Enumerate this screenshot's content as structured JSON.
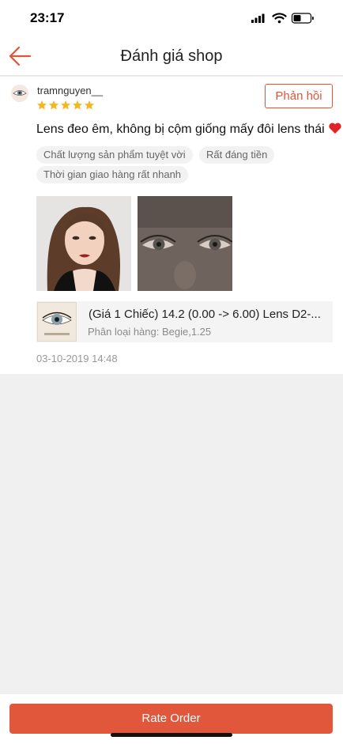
{
  "status_bar": {
    "time": "23:17",
    "icons": [
      "signal-icon",
      "wifi-icon",
      "battery-icon"
    ]
  },
  "nav": {
    "title": "Đánh giá shop",
    "back_icon": "back-arrow-icon"
  },
  "review": {
    "username": "tramnguyen__",
    "rating": 5,
    "reply_label": "Phản hồi",
    "comment": "Lens đeo êm, không bị cộm giống mấy đôi lens thái",
    "tags": [
      "Chất lượng sản phẩm tuyệt vời",
      "Rất đáng tiền",
      "Thời gian giao hàng rất nhanh"
    ],
    "product": {
      "name": "(Giá 1 Chiếc) 14.2 (0.00 -> 6.00) Lens D2-...",
      "variant": "Phân loại hàng: Begie,1.25"
    },
    "date": "03-10-2019 14:48"
  },
  "footer": {
    "rate_label": "Rate Order"
  },
  "colors": {
    "accent": "#e0553a",
    "star": "#f5b623",
    "heart": "#e0242a"
  }
}
